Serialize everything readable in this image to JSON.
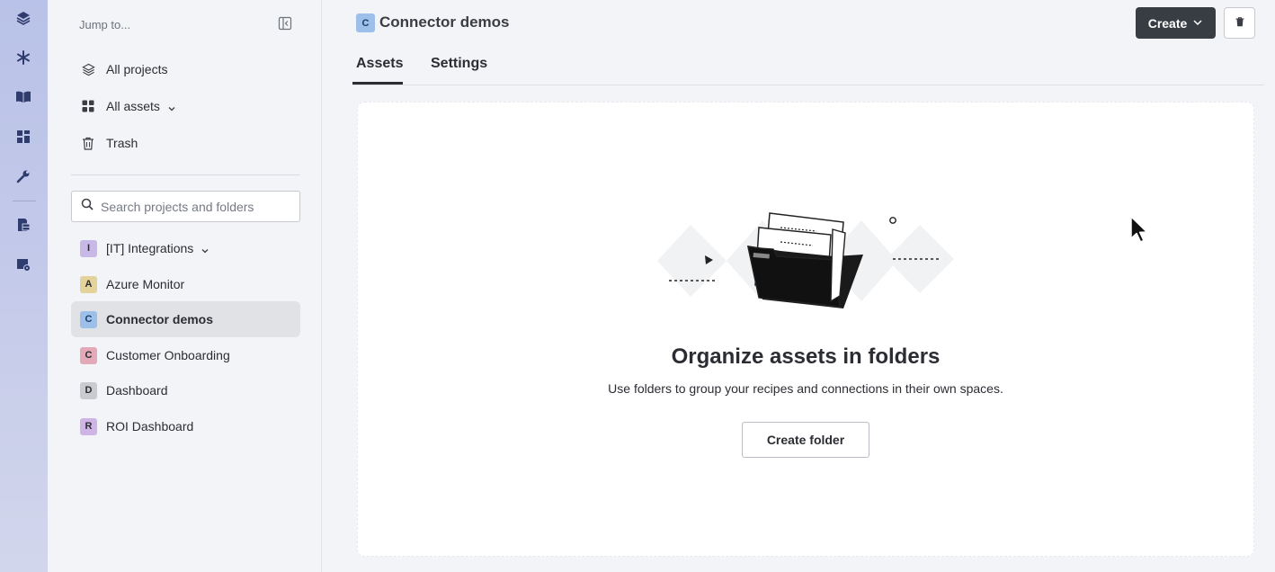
{
  "rail": {
    "icons": [
      "layers-icon",
      "snowflake-icon",
      "book-icon",
      "dashboard-icon",
      "wrench-icon",
      "document-table-icon",
      "calendar-gear-icon"
    ]
  },
  "sidebar": {
    "jump_label": "Jump to...",
    "nav": [
      {
        "label": "All projects",
        "icon": "layers-icon"
      },
      {
        "label": "All assets",
        "icon": "grid-icon",
        "has_dropdown": true
      },
      {
        "label": "Trash",
        "icon": "trash-icon"
      }
    ],
    "search_placeholder": "Search projects and folders",
    "projects": [
      {
        "letter": "I",
        "label": "[IT] Integrations",
        "color": "#c7b8e8",
        "has_dropdown": true
      },
      {
        "letter": "A",
        "label": "Azure Monitor",
        "color": "#e3d39a"
      },
      {
        "letter": "C",
        "label": "Connector demos",
        "color": "#9dc0ea",
        "active": true
      },
      {
        "letter": "C",
        "label": "Customer Onboarding",
        "color": "#e3a9b8"
      },
      {
        "letter": "D",
        "label": "Dashboard",
        "color": "#c9cbd0"
      },
      {
        "letter": "R",
        "label": "ROI Dashboard",
        "color": "#cfb5e6"
      }
    ]
  },
  "header": {
    "badge_letter": "C",
    "title": "Connector demos",
    "create_label": "Create"
  },
  "tabs": [
    {
      "label": "Assets",
      "active": true
    },
    {
      "label": "Settings",
      "active": false
    }
  ],
  "empty_state": {
    "title": "Organize assets in folders",
    "description": "Use folders to group your recipes and connections in their own spaces.",
    "button_label": "Create folder"
  }
}
